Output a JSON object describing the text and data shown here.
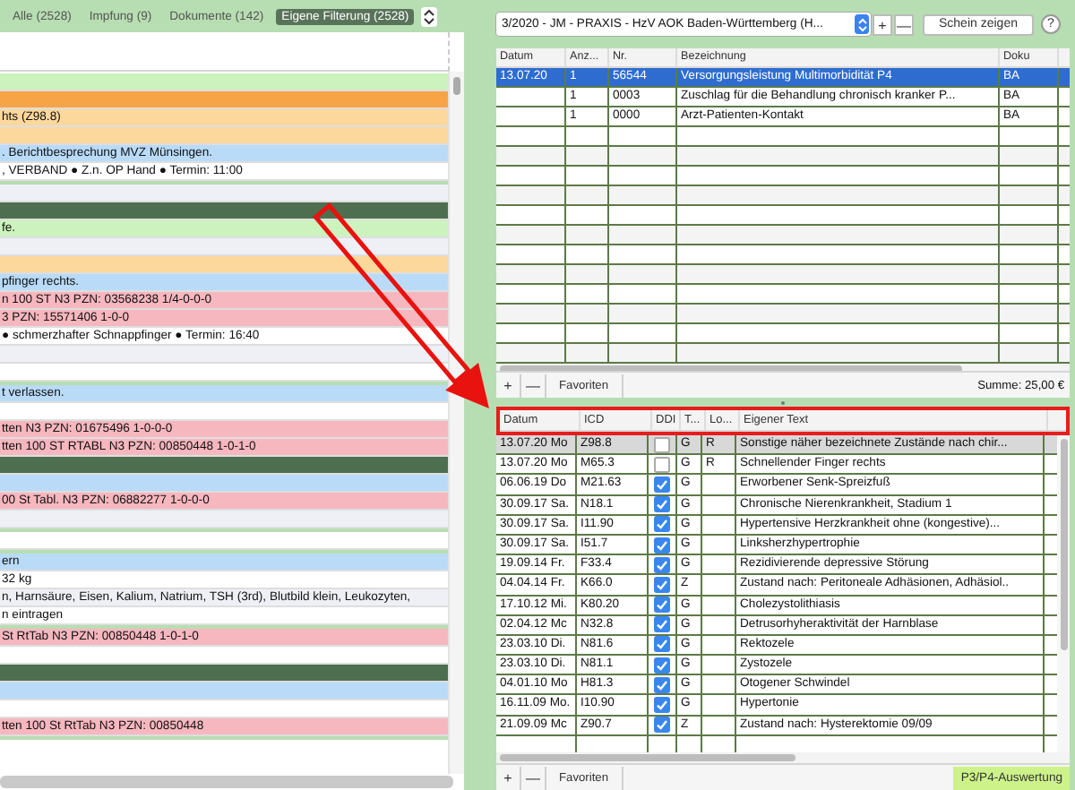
{
  "left_panel": {
    "tabs": [
      {
        "label": "Alle (2528)",
        "selected": false
      },
      {
        "label": "Impfung (9)",
        "selected": false
      },
      {
        "label": "Dokumente (142)",
        "selected": false
      },
      {
        "label": "Eigene Filterung (2528)",
        "selected": true
      }
    ],
    "groups": [
      {
        "rows": [
          {
            "color": "#ccf3bd"
          },
          {
            "color": "#f6a446"
          },
          {
            "color": "#fdd89c",
            "text": "hts (Z98.8)"
          },
          {
            "color": "#fdd89c"
          },
          {
            "color": "#b9dbf8",
            "text": ". Berichtbesprechung MVZ Münsingen."
          },
          {
            "color": "#ffffff",
            "text": ", VERBAND ● Z.n. OP Hand ● Termin: 11:00"
          }
        ]
      },
      {
        "rows": [
          {
            "color": "#eef0f6"
          },
          {
            "color": "#4e6f4f"
          },
          {
            "color": "#ccf3bd",
            "text": "fe."
          },
          {
            "color": "#eef0f6"
          },
          {
            "color": "#fdd89c"
          },
          {
            "color": "#b9dbf8",
            "text": "pfinger rechts."
          },
          {
            "color": "#f7b7bf",
            "text": "n 100 ST N3 PZN: 03568238 1/4-0-0-0"
          },
          {
            "color": "#f7b7bf",
            "text": "3 PZN: 15571406 1-0-0"
          },
          {
            "color": "#ffffff",
            "text": "● schmerzhafter Schnappfinger ● Termin: 16:40"
          },
          {
            "color": "#eef0f6"
          },
          {
            "color": "#ffffff"
          }
        ]
      },
      {
        "rows": [
          {
            "color": "#b9dbf8",
            "text": "t verlassen."
          },
          {
            "color": "#ffffff"
          },
          {
            "color": "#f7b7bf",
            "text": "tten N3 PZN: 01675496 1-0-0-0"
          },
          {
            "color": "#f7b7bf",
            "text": "tten 100 ST RTABL N3 PZN: 00850448 1-0-1-0"
          },
          {
            "color": "#4e6f4f"
          },
          {
            "color": "#b9dbf8"
          },
          {
            "color": "#f7b7bf",
            "text": "00 St Tabl. N3 PZN: 06882277 1-0-0-0"
          },
          {
            "color": "#eef0f6"
          }
        ]
      },
      {
        "rows": [
          {
            "color": "#ffffff"
          }
        ]
      },
      {
        "rows": [
          {
            "color": "#b9dbf8",
            "text": "ern"
          },
          {
            "color": "#ffffff",
            "text": "32 kg"
          },
          {
            "color": "#eef0f6",
            "text": "n, Harnsäure, Eisen, Kalium, Natrium, TSH (3rd), Blutbild klein, Leukozyten,"
          },
          {
            "color": "#ffffff",
            "text": "n eintragen"
          }
        ]
      },
      {
        "rows": [
          {
            "color": "#f7b7bf",
            "text": "St RtTab N3 PZN: 00850448 1-0-1-0"
          },
          {
            "color": "#ffffff"
          },
          {
            "color": "#4e6f4f"
          },
          {
            "color": "#b9dbf8"
          },
          {
            "color": "#ffffff"
          },
          {
            "color": "#f7b7bf",
            "text": "tten 100 St RtTab N3 PZN: 00850448"
          }
        ]
      }
    ]
  },
  "billing": {
    "case_selector": {
      "value": "3/2020 - JM - PRAXIS - HzV AOK Baden-Württemberg (H..."
    },
    "add_button": "+",
    "remove_button": "—",
    "show_button": "Schein zeigen",
    "help_button": "?",
    "table": {
      "columns": [
        "Datum",
        "Anz...",
        "Nr.",
        "Bezeichnung",
        "Doku"
      ],
      "rows": [
        {
          "cells": [
            "13.07.20",
            "1",
            "56544",
            "Versorgungsleistung Multimorbidität P4",
            "BA"
          ],
          "selected": true
        },
        {
          "cells": [
            "",
            "1",
            "0003",
            "Zuschlag für die Behandlung chronisch kranker P...",
            "BA"
          ],
          "selected": false
        },
        {
          "cells": [
            "",
            "1",
            "0000",
            "Arzt-Patienten-Kontakt",
            "BA"
          ],
          "selected": false
        }
      ]
    },
    "toolbar": {
      "buttons": [
        "+",
        "—",
        "Favoriten"
      ],
      "sum": "Summe: 25,00 €"
    }
  },
  "diagnoses": {
    "columns": [
      "Datum",
      "ICD",
      "DDI",
      "T...",
      "Lo...",
      "Eigener Text"
    ],
    "rows": [
      {
        "date": "13.07.20 Mo",
        "icd": "Z98.8",
        "ddi": false,
        "t": "G",
        "lo": "R",
        "text": "Sonstige näher bezeichnete Zustände nach chir...",
        "selected": true
      },
      {
        "date": "13.07.20 Mo",
        "icd": "M65.3",
        "ddi": false,
        "t": "G",
        "lo": "R",
        "text": "Schnellender Finger rechts",
        "selected": false
      },
      {
        "date": "06.06.19 Do",
        "icd": "M21.63",
        "ddi": true,
        "t": "G",
        "text": "Erworbener Senk-Spreizfuß",
        "selected": false
      },
      {
        "date": "30.09.17 Sa.",
        "icd": "N18.1",
        "ddi": true,
        "t": "G",
        "text": "Chronische Nierenkrankheit, Stadium 1",
        "selected": false
      },
      {
        "date": "30.09.17 Sa.",
        "icd": "I11.90",
        "ddi": true,
        "t": "G",
        "text": "Hypertensive Herzkrankheit ohne (kongestive)...",
        "selected": false
      },
      {
        "date": "30.09.17 Sa.",
        "icd": "I51.7",
        "ddi": true,
        "t": "G",
        "text": "Linksherzhypertrophie",
        "selected": false
      },
      {
        "date": "19.09.14 Fr.",
        "icd": "F33.4",
        "ddi": true,
        "t": "G",
        "text": "Rezidivierende depressive Störung",
        "selected": false
      },
      {
        "date": "04.04.14 Fr.",
        "icd": "K66.0",
        "ddi": true,
        "t": "Z",
        "text": "Zustand nach: Peritoneale Adhäsionen, Adhäsiol..",
        "selected": false
      },
      {
        "date": "17.10.12 Mi.",
        "icd": "K80.20",
        "ddi": true,
        "t": "G",
        "text": "Cholezystolithiasis",
        "selected": false
      },
      {
        "date": "02.04.12 Mc",
        "icd": "N32.8",
        "ddi": true,
        "t": "G",
        "text": "Detrusorhyheraktivität der Harnblase",
        "selected": false
      },
      {
        "date": "23.03.10 Di.",
        "icd": "N81.6",
        "ddi": true,
        "t": "G",
        "text": "Rektozele",
        "selected": false
      },
      {
        "date": "23.03.10 Di.",
        "icd": "N81.1",
        "ddi": true,
        "t": "G",
        "text": "Zystozele",
        "selected": false
      },
      {
        "date": "04.01.10 Mo",
        "icd": "H81.3",
        "ddi": true,
        "t": "G",
        "text": "Otogener Schwindel",
        "selected": false
      },
      {
        "date": "16.11.09 Mo.",
        "icd": "I10.90",
        "ddi": true,
        "t": "G",
        "text": "Hypertonie",
        "selected": false
      },
      {
        "date": "21.09.09 Mc",
        "icd": "Z90.7",
        "ddi": true,
        "t": "Z",
        "text": "Zustand nach: Hysterektomie 09/09",
        "selected": false
      }
    ],
    "toolbar": {
      "buttons": [
        "+",
        "—",
        "Favoriten"
      ],
      "evaluation_button": "P3/P4-Auswertung"
    }
  }
}
